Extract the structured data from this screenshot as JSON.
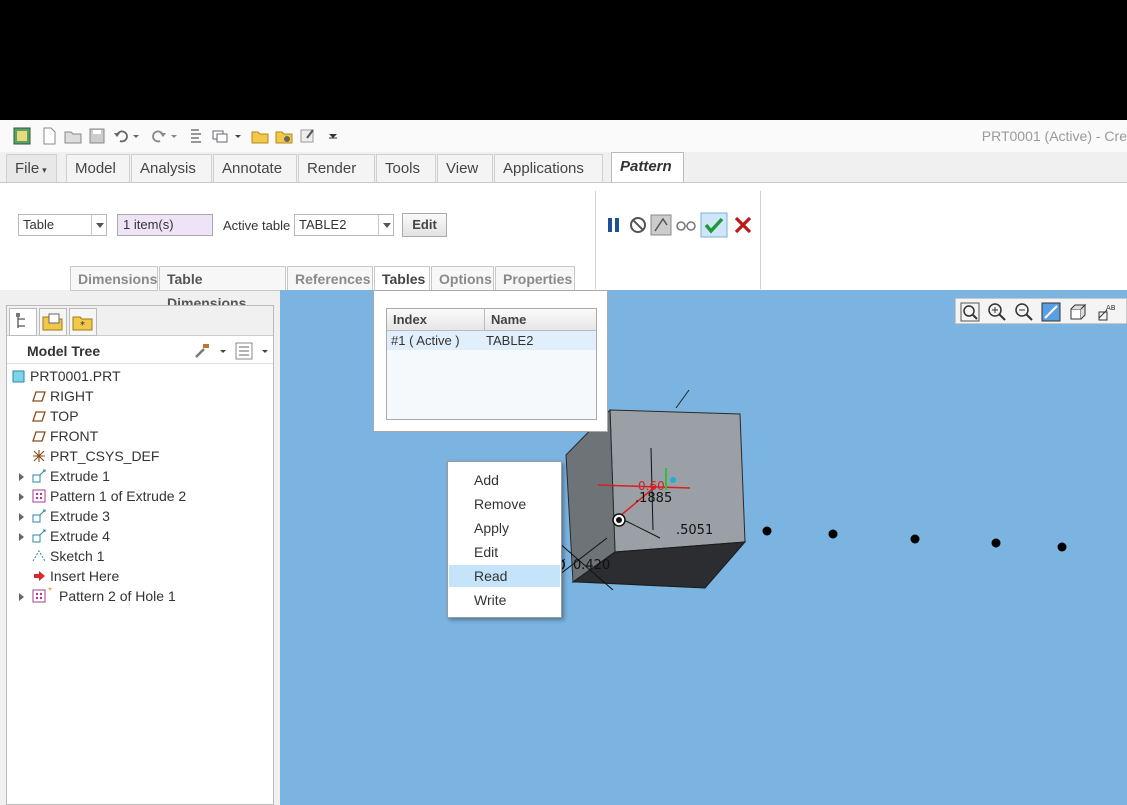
{
  "window": {
    "title": "PRT0001 (Active) - Cre"
  },
  "tabs": {
    "file": "File",
    "model": "Model",
    "analysis": "Analysis",
    "annotate": "Annotate",
    "render": "Render",
    "tools": "Tools",
    "view": "View",
    "applications": "Applications",
    "pattern": "Pattern"
  },
  "ribbon": {
    "type_value": "Table",
    "items_value": "1 item(s)",
    "active_table_label": "Active table",
    "active_table_value": "TABLE2",
    "edit_label": "Edit"
  },
  "subtabs": {
    "dimensions": "Dimensions",
    "table_dimensions": "Table Dimensions",
    "references": "References",
    "tables": "Tables",
    "options": "Options",
    "properties": "Properties"
  },
  "model_tree": {
    "title": "Model Tree",
    "items": [
      {
        "label": "PRT0001.PRT",
        "icon": "part-icon"
      },
      {
        "label": "RIGHT",
        "icon": "datum-plane-icon"
      },
      {
        "label": "TOP",
        "icon": "datum-plane-icon"
      },
      {
        "label": "FRONT",
        "icon": "datum-plane-icon"
      },
      {
        "label": "PRT_CSYS_DEF",
        "icon": "csys-icon"
      },
      {
        "label": "Extrude 1",
        "icon": "extrude-icon"
      },
      {
        "label": "Pattern 1 of Extrude 2",
        "icon": "pattern-icon"
      },
      {
        "label": "Extrude 3",
        "icon": "extrude-icon"
      },
      {
        "label": "Extrude 4",
        "icon": "extrude-icon"
      },
      {
        "label": "Sketch 1",
        "icon": "sketch-icon"
      },
      {
        "label": "Insert Here",
        "icon": "insert-arrow-icon"
      },
      {
        "label": "Pattern 2 of Hole 1",
        "icon": "pattern-icon"
      }
    ]
  },
  "tables_panel": {
    "col_index": "Index",
    "col_name": "Name",
    "row_index": "#1 ( Active )",
    "row_name": "TABLE2"
  },
  "context_menu": {
    "items": [
      "Add",
      "Remove",
      "Apply",
      "Edit",
      "Read",
      "Write"
    ],
    "highlighted": "Read"
  },
  "model_view": {
    "dim_1": ".1885",
    "dim_2": ".5051",
    "dim_3": "0.420",
    "dim_4": "0.60",
    "diameter_symbol": "Ø"
  },
  "colors": {
    "viewport_bg": "#7bb3e1",
    "menu_highlight": "#c6e4f9",
    "ok_green": "#3aa63a",
    "cancel_red": "#c01818"
  }
}
